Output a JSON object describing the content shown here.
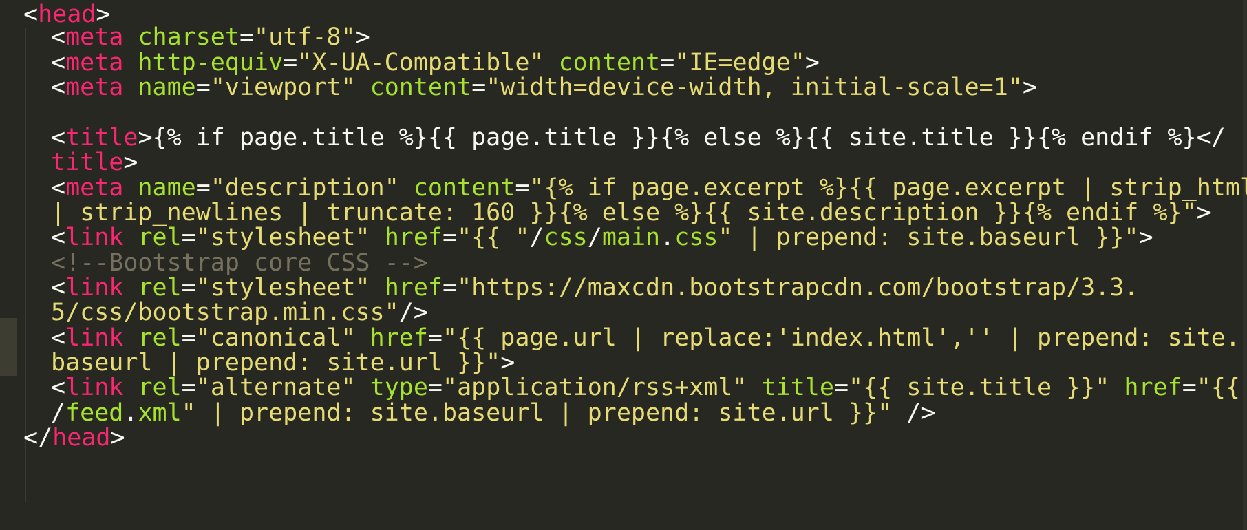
{
  "editor": {
    "theme_colors": {
      "background": "#272822",
      "tag": "#f92672",
      "attribute": "#a6e22e",
      "string": "#e6db74",
      "text": "#f8f8f2",
      "comment": "#75715e"
    },
    "lines": [
      [
        {
          "c": "p",
          "t": "<"
        },
        {
          "c": "t",
          "t": "head"
        },
        {
          "c": "p",
          "t": ">"
        }
      ],
      [
        {
          "c": "p",
          "t": "<"
        },
        {
          "c": "t",
          "t": "meta"
        },
        {
          "c": "p",
          "t": " "
        },
        {
          "c": "a",
          "t": "charset"
        },
        {
          "c": "p",
          "t": "="
        },
        {
          "c": "s",
          "t": "\"utf-8\""
        },
        {
          "c": "p",
          "t": ">"
        }
      ],
      [
        {
          "c": "p",
          "t": "<"
        },
        {
          "c": "t",
          "t": "meta"
        },
        {
          "c": "p",
          "t": " "
        },
        {
          "c": "a",
          "t": "http-equiv"
        },
        {
          "c": "p",
          "t": "="
        },
        {
          "c": "s",
          "t": "\"X-UA-Compatible\""
        },
        {
          "c": "p",
          "t": " "
        },
        {
          "c": "a",
          "t": "content"
        },
        {
          "c": "p",
          "t": "="
        },
        {
          "c": "s",
          "t": "\"IE=edge\""
        },
        {
          "c": "p",
          "t": ">"
        }
      ],
      [
        {
          "c": "p",
          "t": "<"
        },
        {
          "c": "t",
          "t": "meta"
        },
        {
          "c": "p",
          "t": " "
        },
        {
          "c": "a",
          "t": "name"
        },
        {
          "c": "p",
          "t": "="
        },
        {
          "c": "s",
          "t": "\"viewport\""
        },
        {
          "c": "p",
          "t": " "
        },
        {
          "c": "a",
          "t": "content"
        },
        {
          "c": "p",
          "t": "="
        },
        {
          "c": "s",
          "t": "\"width=device-width, initial-scale=1\""
        },
        {
          "c": "p",
          "t": ">"
        }
      ],
      [],
      [
        {
          "c": "p",
          "t": "<"
        },
        {
          "c": "t",
          "t": "title"
        },
        {
          "c": "p",
          "t": ">{% if page.title %}{{ page.title }}{% else %}{{ site.title }}{% endif %}</"
        }
      ],
      [
        {
          "c": "t",
          "t": "title"
        },
        {
          "c": "p",
          "t": ">"
        }
      ],
      [
        {
          "c": "p",
          "t": "<"
        },
        {
          "c": "t",
          "t": "meta"
        },
        {
          "c": "p",
          "t": " "
        },
        {
          "c": "a",
          "t": "name"
        },
        {
          "c": "p",
          "t": "="
        },
        {
          "c": "s",
          "t": "\"description\""
        },
        {
          "c": "p",
          "t": " "
        },
        {
          "c": "a",
          "t": "content"
        },
        {
          "c": "p",
          "t": "="
        },
        {
          "c": "s",
          "t": "\"{% if page.excerpt %}{{ page.excerpt | strip_html"
        }
      ],
      [
        {
          "c": "s",
          "t": "| strip_newlines | truncate: 160 }}{% else %}{{ site.description }}{% endif %}\""
        },
        {
          "c": "p",
          "t": ">"
        }
      ],
      [
        {
          "c": "p",
          "t": "<"
        },
        {
          "c": "t",
          "t": "link"
        },
        {
          "c": "p",
          "t": " "
        },
        {
          "c": "a",
          "t": "rel"
        },
        {
          "c": "p",
          "t": "="
        },
        {
          "c": "s",
          "t": "\"stylesheet\""
        },
        {
          "c": "p",
          "t": " "
        },
        {
          "c": "a",
          "t": "href"
        },
        {
          "c": "p",
          "t": "="
        },
        {
          "c": "s",
          "t": "\"{{ \""
        },
        {
          "c": "p",
          "t": "/"
        },
        {
          "c": "a",
          "t": "css"
        },
        {
          "c": "p",
          "t": "/"
        },
        {
          "c": "a",
          "t": "main"
        },
        {
          "c": "p",
          "t": "."
        },
        {
          "c": "a",
          "t": "css"
        },
        {
          "c": "s",
          "t": "\" | prepend: site.baseurl }}\""
        },
        {
          "c": "p",
          "t": ">"
        }
      ],
      [
        {
          "c": "c",
          "t": "<!--Bootstrap core CSS -->"
        }
      ],
      [
        {
          "c": "p",
          "t": "<"
        },
        {
          "c": "t",
          "t": "link"
        },
        {
          "c": "p",
          "t": " "
        },
        {
          "c": "a",
          "t": "rel"
        },
        {
          "c": "p",
          "t": "="
        },
        {
          "c": "s",
          "t": "\"stylesheet\""
        },
        {
          "c": "p",
          "t": " "
        },
        {
          "c": "a",
          "t": "href"
        },
        {
          "c": "p",
          "t": "="
        },
        {
          "c": "s",
          "t": "\"https://maxcdn.bootstrapcdn.com/bootstrap/3.3."
        }
      ],
      [
        {
          "c": "s",
          "t": "5/css/bootstrap.min.css\""
        },
        {
          "c": "p",
          "t": "/>"
        }
      ],
      [
        {
          "c": "p",
          "t": "<"
        },
        {
          "c": "t",
          "t": "link"
        },
        {
          "c": "p",
          "t": " "
        },
        {
          "c": "a",
          "t": "rel"
        },
        {
          "c": "p",
          "t": "="
        },
        {
          "c": "s",
          "t": "\"canonical\""
        },
        {
          "c": "p",
          "t": " "
        },
        {
          "c": "a",
          "t": "href"
        },
        {
          "c": "p",
          "t": "="
        },
        {
          "c": "s",
          "t": "\"{{ page.url | replace:'index.html','' | prepend: site."
        }
      ],
      [
        {
          "c": "s",
          "t": "baseurl | prepend: site.url }}\""
        },
        {
          "c": "p",
          "t": ">"
        }
      ],
      [
        {
          "c": "p",
          "t": "<"
        },
        {
          "c": "t",
          "t": "link"
        },
        {
          "c": "p",
          "t": " "
        },
        {
          "c": "a",
          "t": "rel"
        },
        {
          "c": "p",
          "t": "="
        },
        {
          "c": "s",
          "t": "\"alternate\""
        },
        {
          "c": "p",
          "t": " "
        },
        {
          "c": "a",
          "t": "type"
        },
        {
          "c": "p",
          "t": "="
        },
        {
          "c": "s",
          "t": "\"application/rss+xml\""
        },
        {
          "c": "p",
          "t": " "
        },
        {
          "c": "a",
          "t": "title"
        },
        {
          "c": "p",
          "t": "="
        },
        {
          "c": "s",
          "t": "\"{{ site.title }}\""
        },
        {
          "c": "p",
          "t": " "
        },
        {
          "c": "a",
          "t": "href"
        },
        {
          "c": "p",
          "t": "="
        },
        {
          "c": "s",
          "t": "\"{{ \""
        }
      ],
      [
        {
          "c": "p",
          "t": "/"
        },
        {
          "c": "a",
          "t": "feed"
        },
        {
          "c": "p",
          "t": "."
        },
        {
          "c": "a",
          "t": "xml"
        },
        {
          "c": "s",
          "t": "\" | prepend: site.baseurl | prepend: site.url }}\""
        },
        {
          "c": "p",
          "t": " />"
        }
      ],
      [
        {
          "c": "p",
          "t": "</"
        },
        {
          "c": "t",
          "t": "head"
        },
        {
          "c": "p",
          "t": ">"
        }
      ]
    ]
  }
}
